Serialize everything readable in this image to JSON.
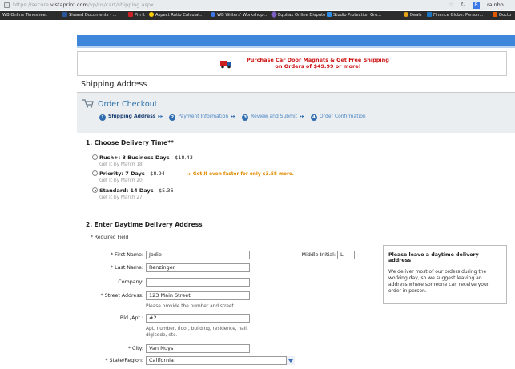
{
  "browser": {
    "url_prefix": "https://secure.",
    "url_domain": "vistaprint.com",
    "url_path": "/vp/ns/cart/shipping.aspx",
    "search_text": "rainbo"
  },
  "bookmarks": [
    {
      "label": "WB Online Timesheet",
      "icon_color": "#444444"
    },
    {
      "label": "Shared Documents - ...",
      "icon_color": "#2b579a"
    },
    {
      "label": "Pin It",
      "icon_color": "#cc2127"
    },
    {
      "label": "Aspect Ratio Calculat...",
      "icon_color": "#ffcc00"
    },
    {
      "label": "WB Writers' Workshop ...",
      "icon_color": "#3b78e7"
    },
    {
      "label": "Equifax Online Dispute",
      "icon_color": "#7b5fc2"
    },
    {
      "label": "Studio Protection Gro...",
      "icon_color": "#2f8de4"
    },
    {
      "label": "Deals",
      "icon_color": "#e8a317"
    },
    {
      "label": "Finance Globe: Person...",
      "icon_color": "#1c74c0"
    },
    {
      "label": "Docto",
      "icon_color": "#e05a00"
    }
  ],
  "promo": {
    "line1": "Purchase Car Door Magnets & Get Free Shipping",
    "line2": "on Orders of $49.99 or more!"
  },
  "page_title": "Shipping Address",
  "checkout": {
    "title": "Order Checkout",
    "steps": [
      {
        "num": "1",
        "label": "Shipping Address",
        "active": true
      },
      {
        "num": "2",
        "label": "Payment Information",
        "active": false
      },
      {
        "num": "3",
        "label": "Review and Submit",
        "active": false
      },
      {
        "num": "4",
        "label": "Order Confirmation",
        "active": false
      }
    ]
  },
  "delivery": {
    "title": "1. Choose Delivery Time**",
    "options": [
      {
        "name": "Rush+: 3 Business Days",
        "price": " - $18.43",
        "sub": "Get it by March 18.",
        "selected": false
      },
      {
        "name": "Priority: 7 Days",
        "price": " - $8.94",
        "sub": "Get it by March 20.",
        "selected": false
      },
      {
        "name": "Standard: 14 Days",
        "price": " - $5.36",
        "sub": "Get it by March 27.",
        "selected": true
      }
    ],
    "upsell": "Get it even faster for only $3.58 more."
  },
  "address": {
    "title": "2. Enter Daytime Delivery Address",
    "required_note": "* Required Field",
    "first_name_label": "* First Name:",
    "first_name": "Jodie",
    "middle_initial_label": "Middle Initial:",
    "middle_initial": "L",
    "last_name_label": "* Last Name:",
    "last_name": "Renzinger",
    "company_label": "Company:",
    "company": "",
    "street_label": "* Street Address:",
    "street": "123 Main Street",
    "street_hint": "Please provide the number and street.",
    "apt_label": "Bld./Apt.:",
    "apt": "#2",
    "apt_hint_1": "Apt. number, floor, building, residence, hall,",
    "apt_hint_2": "digicode, etc.",
    "city_label": "* City:",
    "city": "Van Nuys",
    "state_label": "* State/Region:",
    "state": "California"
  },
  "infobox": {
    "heading": "Please leave a daytime delivery address",
    "body": "We deliver most of our orders during the working day, so we suggest leaving an address where someone can receive your order in person."
  },
  "colors": {
    "accent_blue": "#3d86d9",
    "promo_red": "#cc1111",
    "upsell_orange": "#e28a00",
    "checkout_title": "#2a6fa8"
  }
}
